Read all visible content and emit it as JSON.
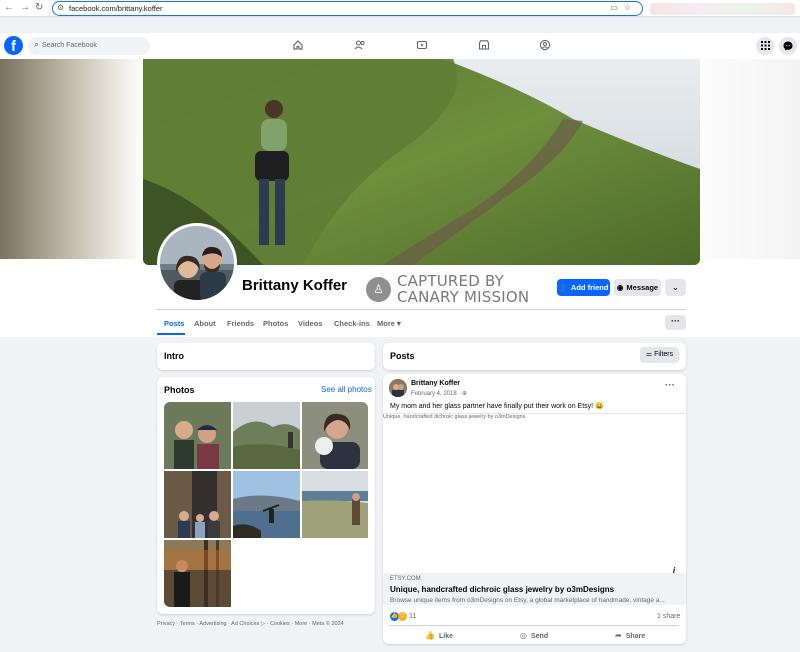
{
  "browser": {
    "url": "facebook.com/brittany.koffer",
    "back": "←",
    "forward": "→",
    "reload": "↻"
  },
  "topbar": {
    "logo": "f",
    "search_placeholder": "Search Facebook"
  },
  "profile": {
    "name": "Brittany Koffer",
    "watermark_line1": "CAPTURED BY",
    "watermark_line2": "CANARY MISSION",
    "add_friend": "Add friend",
    "message": "Message",
    "tabs": [
      "Posts",
      "About",
      "Friends",
      "Photos",
      "Videos",
      "Check-ins",
      "More ▾"
    ],
    "more_dots": "···"
  },
  "intro": {
    "title": "Intro"
  },
  "photos": {
    "title": "Photos",
    "see_all": "See all photos"
  },
  "footer": "Privacy · Terms · Advertising · Ad Choices ▷ · Cookies · More · Meta © 2024",
  "posts": {
    "title": "Posts",
    "filters": "Filters",
    "author": "Brittany Koffer",
    "date": "February 4, 2018 · ⊕",
    "dots": "···",
    "text": "My mom and her glass partner have finally put their work on Etsy! 😀",
    "image_alt": "Unique, handcrafted dichroic glass jewelry by o3mDesigns",
    "link": {
      "domain": "ETSY.COM",
      "title": "Unique, handcrafted dichroic glass jewelry by o3mDesigns",
      "description": "Browse unique items from o3mDesigns on Etsy, a global marketplace of handmade, vintage a..."
    },
    "reaction_count": "11",
    "share_count": "1 share",
    "like": "Like",
    "send": "Send",
    "share": "Share"
  },
  "colors": {
    "facebook_blue": "#0866ff",
    "background": "#f0f2f5"
  },
  "icons": [
    "home-icon",
    "friends-icon",
    "watch-icon",
    "marketplace-icon",
    "groups-icon",
    "menu-grid-icon",
    "messenger-icon"
  ]
}
